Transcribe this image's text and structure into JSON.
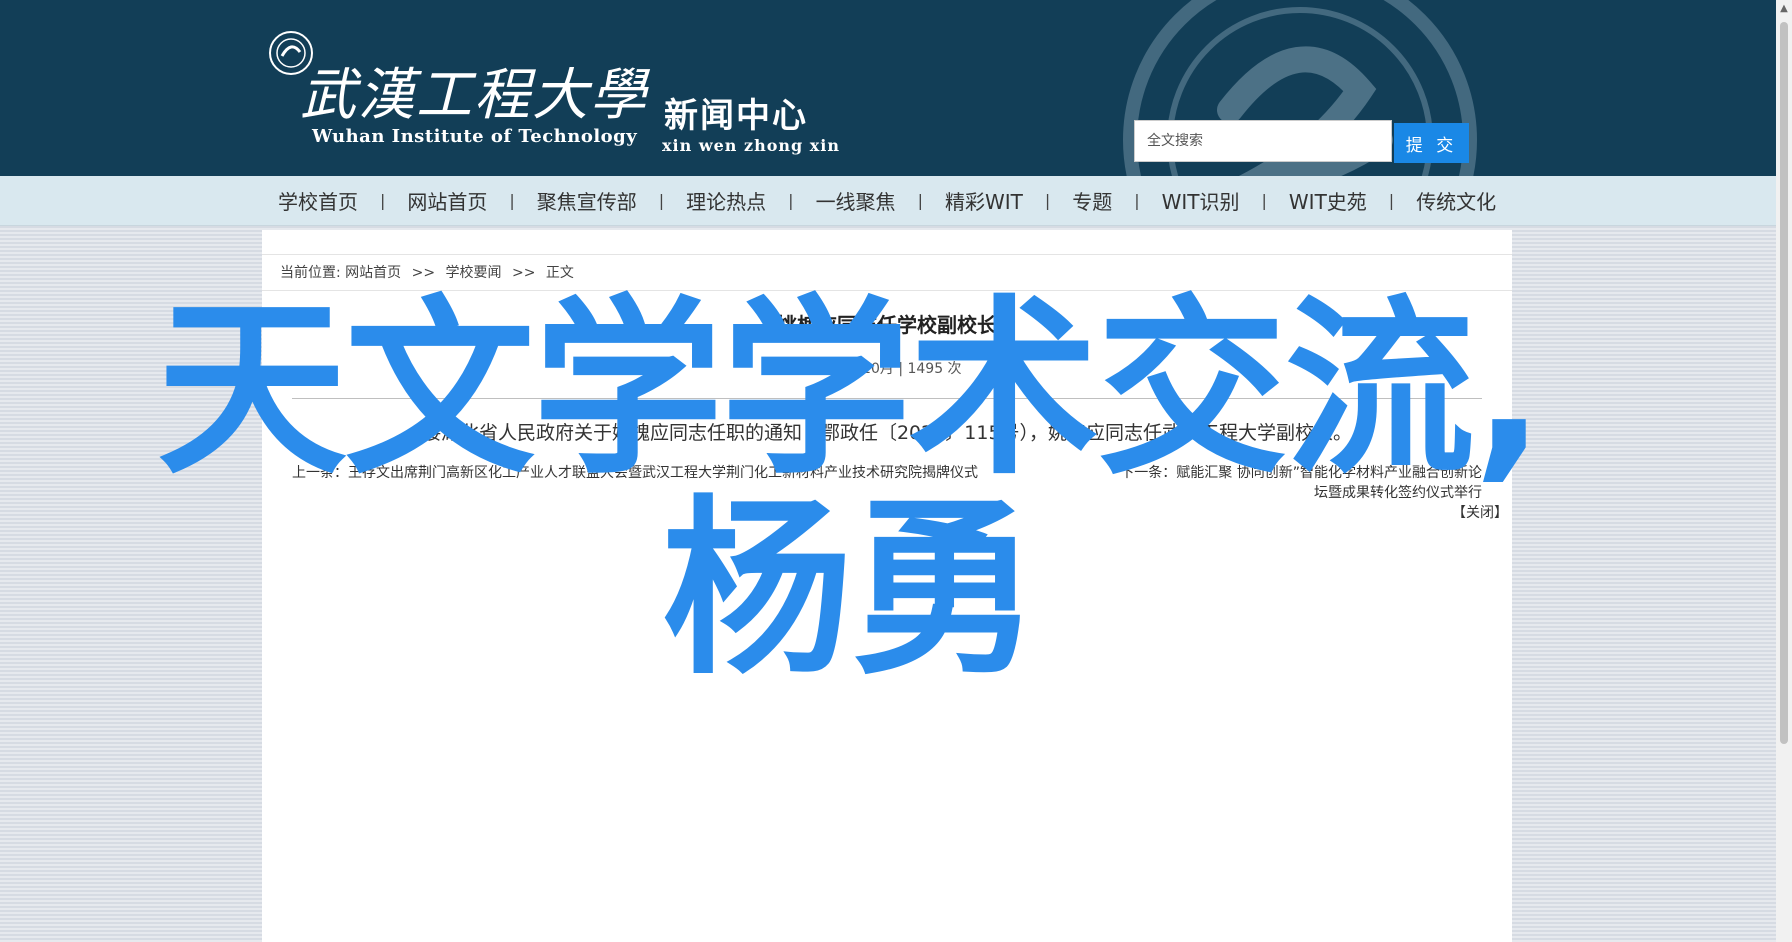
{
  "header": {
    "school_name_cn": "武漢工程大學",
    "school_name_en": "Wuhan Institute of Technology",
    "center_name_cn": "新闻中心",
    "center_name_en": "xin wen zhong xin",
    "search": {
      "placeholder": "全文搜索",
      "button_label": "提 交"
    }
  },
  "nav": {
    "items": [
      "学校首页",
      "网站首页",
      "聚焦宣传部",
      "理论热点",
      "一线聚焦",
      "精彩WIT",
      "专题",
      "WIT识别",
      "WIT史苑",
      "传统文化"
    ],
    "separator": "|"
  },
  "breadcrumb": {
    "prefix": "当前位置:",
    "items": [
      "网站首页",
      "学校要闻",
      "正文"
    ],
    "separator": ">>"
  },
  "article": {
    "title": "姚槐应同志任学校副校长",
    "meta": "2023年10月 | 1495 次",
    "body": "接湖北省人民政府关于姚槐应同志任职的通知（鄂政任〔2023〕115号），姚槐应同志任武汉工程大学副校长。",
    "prev": "上一条：王存文出席荆门高新区化工产业人才联盟大会暨武汉工程大学荆门化工新材料产业技术研究院揭牌仪式",
    "next": "下一条：赋能汇聚 协同创新”智能化学材料产业融合创新论",
    "next_cont": "坛暨成果转化签约仪式举行",
    "close": "【关闭】"
  },
  "overlay_text": "天文学学术交流,杨勇",
  "colors": {
    "header_bg": "#123e57",
    "nav_bg": "#d9e8ef",
    "search_button": "#1a88e6",
    "overlay": "#2b8ceb"
  }
}
